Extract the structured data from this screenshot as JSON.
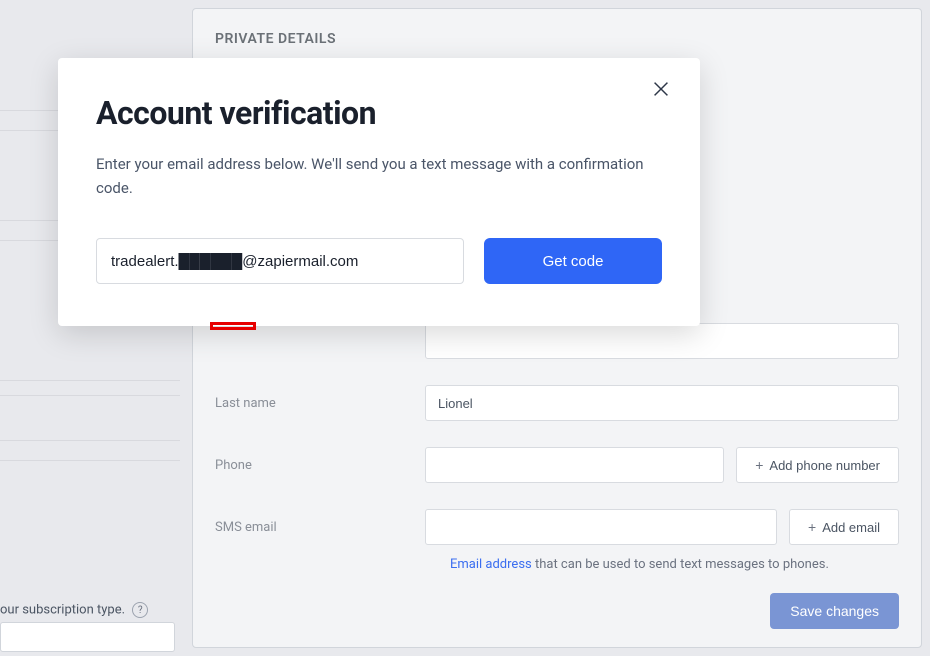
{
  "sidebar": {
    "subscription_text": "our subscription type.",
    "help": "?"
  },
  "section": {
    "title": "PRIVATE DETAILS"
  },
  "form": {
    "last_name": {
      "label": "Last name",
      "value": "Lionel"
    },
    "phone": {
      "label": "Phone",
      "value": "",
      "add_btn": "Add phone number"
    },
    "sms_email": {
      "label": "SMS email",
      "value": "",
      "add_btn": "Add email",
      "helper_link": "Email address",
      "helper_text": " that can be used to send text messages to phones."
    },
    "save": "Save changes"
  },
  "modal": {
    "title": "Account verification",
    "description": "Enter your email address below. We'll send you a text message with a confirmation code.",
    "email_value": "tradealert.██████@zapiermail.com",
    "get_code": "Get code"
  }
}
